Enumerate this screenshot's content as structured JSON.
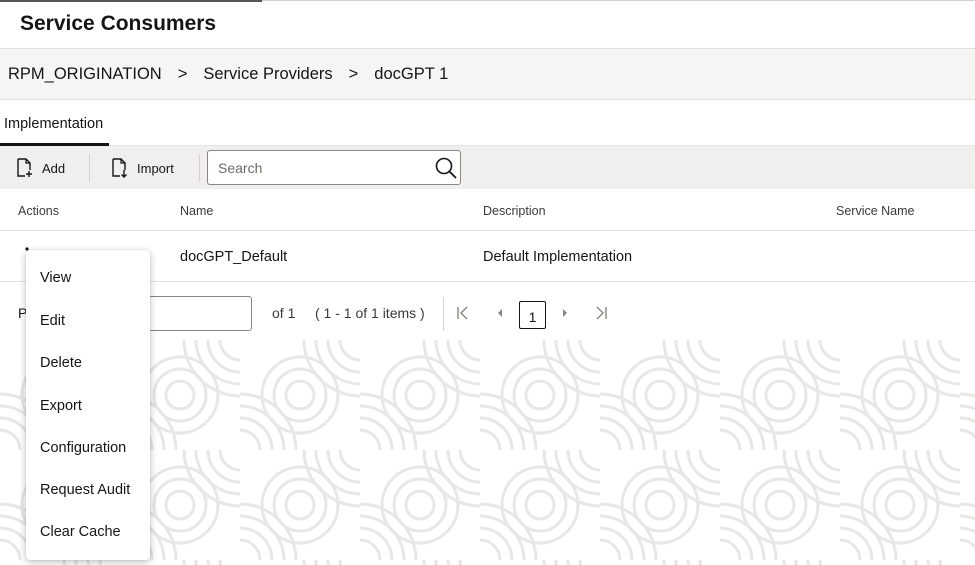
{
  "page_title": "Service Consumers",
  "breadcrumb": {
    "items": [
      "RPM_ORIGINATION",
      "Service Providers",
      "docGPT 1"
    ],
    "separator": ">"
  },
  "tabs": [
    {
      "label": "Implementation",
      "active": true
    }
  ],
  "toolbar": {
    "add_label": "Add",
    "import_label": "Import",
    "search_placeholder": "Search"
  },
  "table": {
    "headers": [
      "Actions",
      "Name",
      "Description",
      "Service Name"
    ],
    "rows": [
      {
        "name": "docGPT_Default",
        "description": "Default Implementation",
        "service_name": ""
      }
    ]
  },
  "pagination": {
    "label": "P",
    "of_text": "of 1",
    "range_text": "( 1 - 1 of 1 items )",
    "current_page": "1"
  },
  "context_menu": {
    "items": [
      "View",
      "Edit",
      "Delete",
      "Export",
      "Configuration",
      "Request Audit",
      "Clear Cache"
    ]
  },
  "icons": {
    "add": "add-document-icon",
    "import": "import-document-icon",
    "search": "search-icon",
    "first": "first-page-icon",
    "prev": "previous-page-icon",
    "next": "next-page-icon",
    "last": "last-page-icon"
  }
}
